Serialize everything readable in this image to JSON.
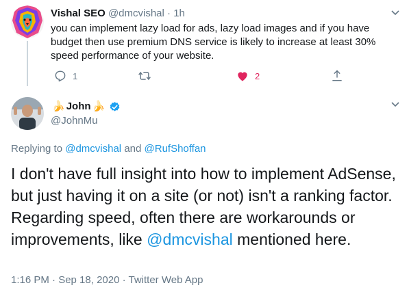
{
  "reply_tweet": {
    "author_name": "Vishal SEO",
    "author_handle": "@dmcvishal",
    "separator": "·",
    "time": "1h",
    "text": "you can implement lazy load for ads, lazy load images and if you have budget then use premium DNS service is likely to increase at least 30% speed performance of your website.",
    "actions": {
      "reply_count": "1",
      "retweet_count": "",
      "like_count": "2",
      "share_count": ""
    },
    "icons": [
      "avatar",
      "chevron-down-icon",
      "reply-icon",
      "retweet-icon",
      "heart-icon",
      "share-icon"
    ]
  },
  "main_tweet": {
    "banana_left": "🍌",
    "author_name": "John",
    "banana_right": "🍌",
    "author_handle": "@JohnMu",
    "replying_prefix": "Replying to",
    "replying_to_1": "@dmcvishal",
    "replying_and": "and",
    "replying_to_2": "@RufShoffan",
    "text_part1": "I don't have full insight into how to implement AdSense, but just having it on a site (or not) isn't a ranking factor. Regarding speed, often there are workarounds or improvements, like ",
    "text_mention": "@dmcvishal",
    "text_part2": " mentioned here.",
    "timestamp": "1:16 PM · Sep 18, 2020 · Twitter Web App",
    "icons": [
      "avatar",
      "verified-badge-icon",
      "chevron-down-icon"
    ]
  },
  "colors": {
    "link": "#1b95e0",
    "muted": "#657786",
    "text": "#14171a",
    "like": "#e0245e",
    "thread_line": "#ccd6dd"
  }
}
